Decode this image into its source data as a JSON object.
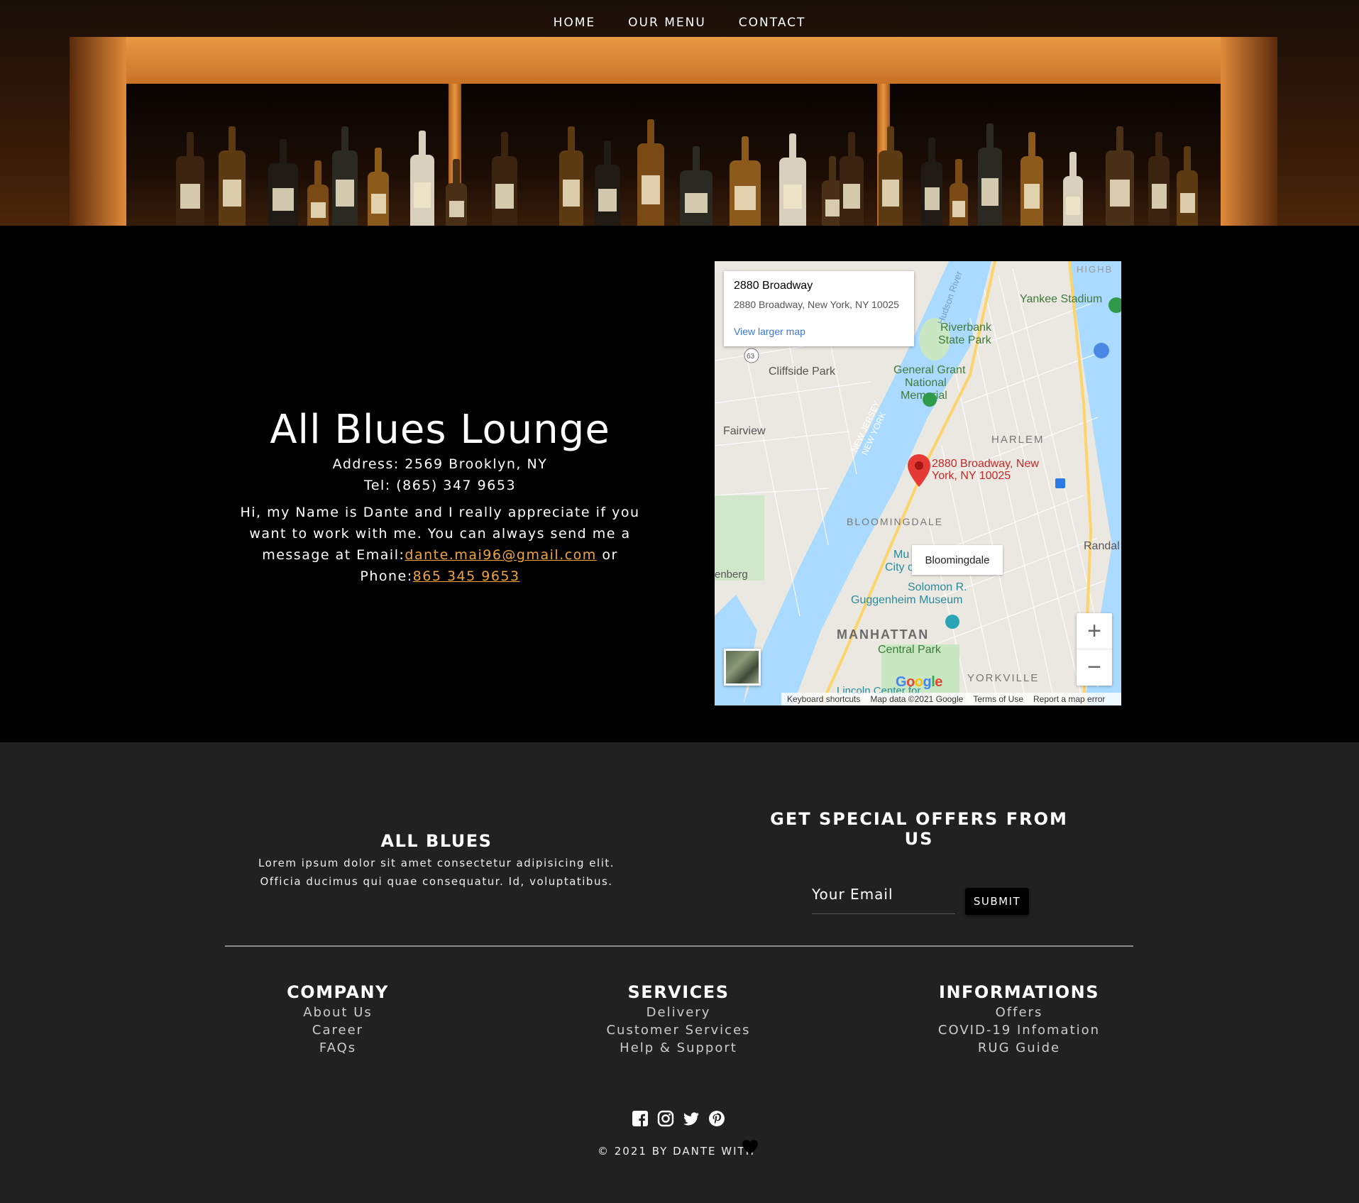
{
  "nav": {
    "home": "HOME",
    "menu": "OUR MENU",
    "contact": "CONTACT"
  },
  "contact": {
    "title": "All Blues Lounge",
    "address": "Address: 2569 Brooklyn, NY",
    "tel": "Tel: (865) 347 9653",
    "bio_1": "Hi, my Name is Dante and I really appreciate if you want to work with me. You can always send me a message at Email:",
    "email": "dante.mai96@gmail.com",
    "bio_2": " or Phone:",
    "phone": "865 345 9653"
  },
  "map": {
    "card_title": "2880 Broadway",
    "card_address": "2880 Broadway, New York, NY 10025",
    "card_link": "View larger map",
    "pin_label_1": "2880 Broadway, New",
    "pin_label_2": "York, NY 10025",
    "bloomingdale": "Bloomingdale",
    "places": {
      "yankee": "Yankee Stadium",
      "riverbank_1": "Riverbank",
      "riverbank_2": "State Park",
      "cliffside": "Cliffside Park",
      "grant_1": "General Grant",
      "grant_2": "National",
      "grant_3": "Memorial",
      "fairview": "Fairview",
      "harlem": "HARLEM",
      "bloomingdale_area": "BLOOMINGDALE",
      "guggenheim_1": "Solomon R.",
      "guggenheim_2": "Guggenheim Museum",
      "manhattan": "MANHATTAN",
      "central_park": "Central Park",
      "yorkville": "YORKVILLE",
      "lincoln": "Lincoln Center for",
      "highb": "HIGHB",
      "randal": "Randal",
      "enberg": "enberg",
      "nj_1": "NEW JERSEY",
      "nj_2": "NEW YORK",
      "mus_1": "Mu",
      "mus_2": "City o",
      "hudson": "Hudson River",
      "route": "63"
    },
    "footer": [
      "Keyboard shortcuts",
      "Map data ©2021 Google",
      "Terms of Use",
      "Report a map error"
    ],
    "google": "Google",
    "zoom_in": "+",
    "zoom_out": "−"
  },
  "footer": {
    "brand_title": "ALL BLUES",
    "brand_text": "Lorem ipsum dolor sit amet consectetur adipisicing elit. Officia ducimus qui quae consequatur. Id, voluptatibus.",
    "offers_title": "GET SPECIAL OFFERS FROM US",
    "email_placeholder": "Your Email",
    "submit": "SUBMIT",
    "columns": [
      {
        "title": "COMPANY",
        "links": [
          "About Us",
          "Career",
          "FAQs"
        ]
      },
      {
        "title": "SERVICES",
        "links": [
          "Delivery",
          "Customer Services",
          "Help & Support"
        ]
      },
      {
        "title": "INFORMATIONS",
        "links": [
          "Offers",
          "COVID-19 Infomation",
          "RUG Guide"
        ]
      }
    ],
    "copyright": "© 2021 BY DANTE WITH",
    "icons": [
      "facebook-icon",
      "instagram-icon",
      "twitter-icon",
      "pinterest-icon",
      "heart-icon"
    ]
  }
}
